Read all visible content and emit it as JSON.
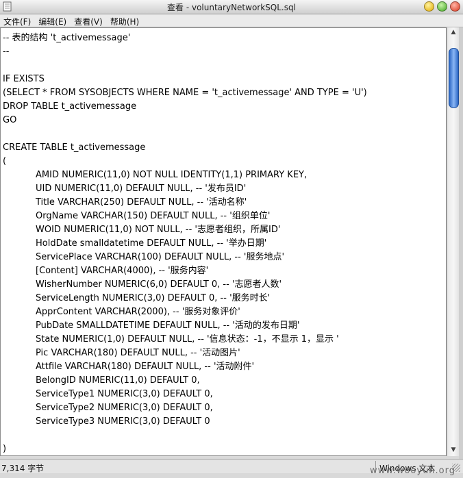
{
  "window": {
    "title": "查看 - voluntaryNetworkSQL.sql",
    "icon": "notepad-icon",
    "controls": [
      "minimize-icon",
      "zoom-icon",
      "close-icon"
    ],
    "control_colors": {
      "minimize": "#e0a800",
      "zoom": "#3ea520",
      "close": "#d8361d"
    }
  },
  "menu": {
    "file": "文件(F)",
    "edit": "编辑(E)",
    "view": "查看(V)",
    "help": "帮助(H)"
  },
  "editor": {
    "lines": [
      "-- 表的结构 't_activemessage'",
      "--",
      "",
      "IF EXISTS",
      "(SELECT * FROM SYSOBJECTS WHERE NAME = 't_activemessage' AND TYPE = 'U')",
      "DROP TABLE t_activemessage",
      "GO",
      "",
      "CREATE TABLE t_activemessage",
      "(",
      "AMID NUMERIC(11,0) NOT NULL IDENTITY(1,1) PRIMARY KEY,",
      "UID NUMERIC(11,0) DEFAULT NULL, -- '发布员ID'",
      "Title VARCHAR(250) DEFAULT NULL, -- '活动名称'",
      "OrgName VARCHAR(150) DEFAULT NULL, -- '组织单位'",
      "WOID NUMERIC(11,0) NOT NULL, -- '志愿者组织，所属ID'",
      "HoldDate smalldatetime DEFAULT NULL, -- '举办日期'",
      "ServicePlace VARCHAR(100) DEFAULT NULL, -- '服务地点'",
      "[Content] VARCHAR(4000), -- '服务内容'",
      "WisherNumber NUMERIC(6,0) DEFAULT 0, -- '志愿者人数'",
      "ServiceLength NUMERIC(3,0) DEFAULT 0, -- '服务时长'",
      "ApprContent VARCHAR(2000), -- '服务对象评价'",
      "PubDate SMALLDATETIME DEFAULT NULL, -- '活动的发布日期'",
      "State NUMERIC(1,0) DEFAULT NULL, -- '信息状态：-1，不显示 1，显示 '",
      "Pic VARCHAR(180) DEFAULT NULL, -- '活动图片'",
      "Attfile VARCHAR(180) DEFAULT NULL, -- '活动附件'",
      "BelongID NUMERIC(11,0) DEFAULT 0,",
      "ServiceType1 NUMERIC(3,0) DEFAULT 0,",
      "ServiceType2 NUMERIC(3,0) DEFAULT 0,",
      "ServiceType3 NUMERIC(3,0) DEFAULT 0",
      "",
      ")"
    ]
  },
  "scrollbar": {
    "up_icon": "arrow-up-icon",
    "down_icon": "arrow-down-icon",
    "thumb_color": "#2c67c4"
  },
  "status": {
    "byte_count": "7,314 字节",
    "encoding": "Windows 文本"
  },
  "watermark": "www.wooyun.org"
}
